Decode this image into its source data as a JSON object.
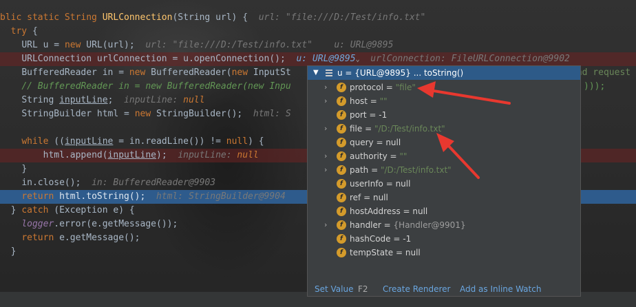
{
  "code": {
    "l0_pre": "blic static String ",
    "l0_method": "URLConnection",
    "l0_sig": "(String url) {",
    "l0_hint": "url: \"file:///D:/Test/info.txt\"",
    "l1_kw": "try",
    "l1_rest": " {",
    "l2_a": "URL u = ",
    "l2_new": "new",
    "l2_b": " URL(url);",
    "l2_hint1": "url: \"file:///D:/Test/info.txt\"",
    "l2_hint2": "u: URL@9895",
    "l3_a": "URLConnection urlConnection = u.openConnection();",
    "l3_hint1": "u: URL@9895",
    "l3_hint2": "urlConnection: FileURLConnection@9902",
    "l4_a": "BufferedReader in = ",
    "l4_new1": "new",
    "l4_b": " BufferedReader(",
    "l4_new2": "new",
    "l4_c": " InputSt",
    "l4_tail": "end request",
    "l5_cmt": "// BufferedReader in = new BufferedReader(new Inpu",
    "l5_tail": ")));",
    "l6_a": "String ",
    "l6_var": "inputLine",
    "l6_b": ";",
    "l6_hint_name": "inputLine:",
    "l6_hint_val": "null",
    "l7_a": "StringBuilder html = ",
    "l7_new": "new",
    "l7_b": " StringBuilder();",
    "l7_hint": "html: S",
    "l9_kw": "while",
    "l9_a": " ((",
    "l9_var": "inputLine",
    "l9_b": " = in.readLine()) != ",
    "l9_null": "null",
    "l9_c": ") {",
    "l10_a": "html.append(",
    "l10_var": "inputLine",
    "l10_b": ");",
    "l10_hint_name": "inputLine:",
    "l10_hint_val": "null",
    "l11": "}",
    "l12_a": "in.close();",
    "l12_hint": "in: BufferedReader@9903",
    "l13_kw": "return",
    "l13_a": " html.toString();",
    "l13_hint": "html: StringBuilder@9904",
    "l14_a": "} ",
    "l14_kw": "catch",
    "l14_b": " (Exception e) {",
    "l15_field": "logger",
    "l15_a": ".error(e.getMessage());",
    "l16_kw": "return",
    "l16_a": " e.getMessage();",
    "l17": "}"
  },
  "popup": {
    "header": "u = {URL@9895} ... toString()",
    "rows": [
      {
        "name": "protocol",
        "eq": " = ",
        "value": "\"file\"",
        "kind": "str"
      },
      {
        "name": "host",
        "eq": " = ",
        "value": "\"\"",
        "kind": "str"
      },
      {
        "name": "port",
        "eq": " = ",
        "value": "-1",
        "kind": "plain"
      },
      {
        "name": "file",
        "eq": " = ",
        "value": "\"/D:/Test/info.txt\"",
        "kind": "str"
      },
      {
        "name": "query",
        "eq": " = ",
        "value": "null",
        "kind": "plain"
      },
      {
        "name": "authority",
        "eq": " = ",
        "value": "\"\"",
        "kind": "str"
      },
      {
        "name": "path",
        "eq": " = ",
        "value": "\"/D:/Test/info.txt\"",
        "kind": "str"
      },
      {
        "name": "userInfo",
        "eq": " = ",
        "value": "null",
        "kind": "plain"
      },
      {
        "name": "ref",
        "eq": " = ",
        "value": "null",
        "kind": "plain"
      },
      {
        "name": "hostAddress",
        "eq": " = ",
        "value": "null",
        "kind": "plain"
      },
      {
        "name": "handler",
        "eq": " = ",
        "value": "{Handler@9901}",
        "kind": "obj"
      },
      {
        "name": "hashCode",
        "eq": " = ",
        "value": "-1",
        "kind": "plain"
      },
      {
        "name": "tempState",
        "eq": " = ",
        "value": "null",
        "kind": "plain"
      }
    ],
    "footer": {
      "set_value": "Set Value",
      "set_value_key": "F2",
      "create_renderer": "Create Renderer",
      "add_inline_watch": "Add as Inline Watch"
    },
    "icon_letter": "f"
  },
  "colors": {
    "annotation_arrow": "#e8382f",
    "header_selected": "#2d5a88",
    "field_icon": "#d49b2b"
  }
}
